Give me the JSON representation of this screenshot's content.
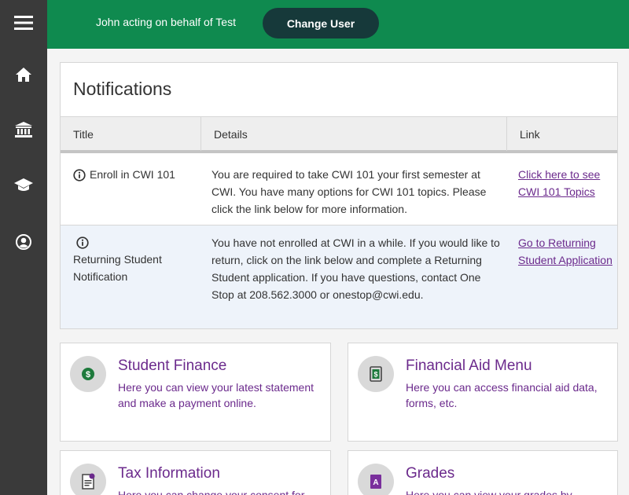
{
  "topbar": {
    "acting_text": "John acting on behalf of Test",
    "change_user_label": "Change User",
    "color": "#0f8a4f"
  },
  "sidebar": {
    "items": [
      {
        "icon": "menu-icon"
      },
      {
        "icon": "home-icon"
      },
      {
        "icon": "institution-icon"
      },
      {
        "icon": "graduation-cap-icon"
      },
      {
        "icon": "user-circle-icon"
      }
    ]
  },
  "notifications": {
    "title": "Notifications",
    "columns": [
      "Title",
      "Details",
      "Link"
    ],
    "rows": [
      {
        "title": "Enroll in CWI 101",
        "details": "You are required to take CWI 101 your first semester at CWI. You have many options for CWI 101 topics. Please click the link below for more information.",
        "link": "Click here to see CWI 101 Topics"
      },
      {
        "title": "Returning Student Notification",
        "details": "You have not enrolled at CWI in a while. If you would like to return, click on the link below and complete a Returning Student application. If you have questions, contact One Stop at 208.562.3000 or onestop@cwi.edu.",
        "link": "Go to Returning Student Application"
      }
    ]
  },
  "tiles": [
    {
      "title": "Student Finance",
      "description": "Here you can view your latest statement and make a payment online.",
      "icon": "dollar-icon"
    },
    {
      "title": "Financial Aid Menu",
      "description": "Here you can access financial aid data, forms, etc.",
      "icon": "money-icon"
    },
    {
      "title": "Tax Information",
      "description": "Here you can change your consent for",
      "icon": "document-icon"
    },
    {
      "title": "Grades",
      "description": "Here you can view your grades by",
      "icon": "grades-icon"
    }
  ]
}
